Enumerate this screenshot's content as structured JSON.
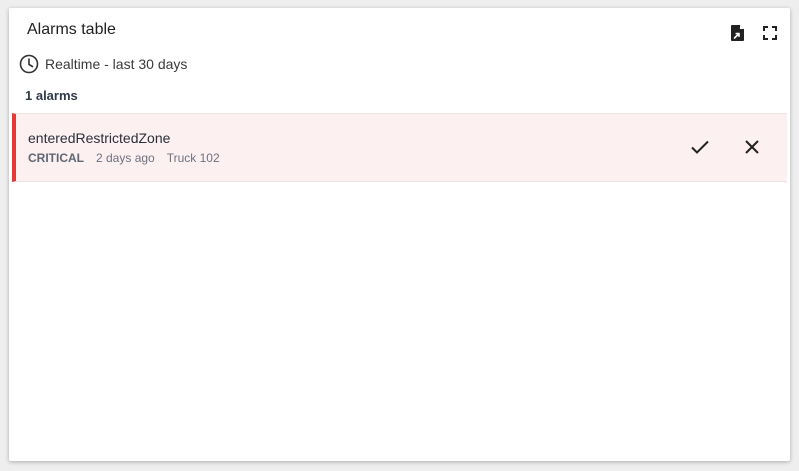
{
  "widget": {
    "title": "Alarms table",
    "header_icons": [
      "export-icon",
      "fullscreen-icon"
    ],
    "timewindow": {
      "icon": "clock-icon",
      "label": "Realtime - last 30 days"
    },
    "alarm_count": "1 alarms"
  },
  "alarms": [
    {
      "name": "enteredRestrictedZone",
      "severity": "CRITICAL",
      "time": "2 days ago",
      "originator": "Truck 102",
      "severity_color": "#e53935",
      "actions": [
        "check-icon",
        "close-icon"
      ]
    }
  ]
}
